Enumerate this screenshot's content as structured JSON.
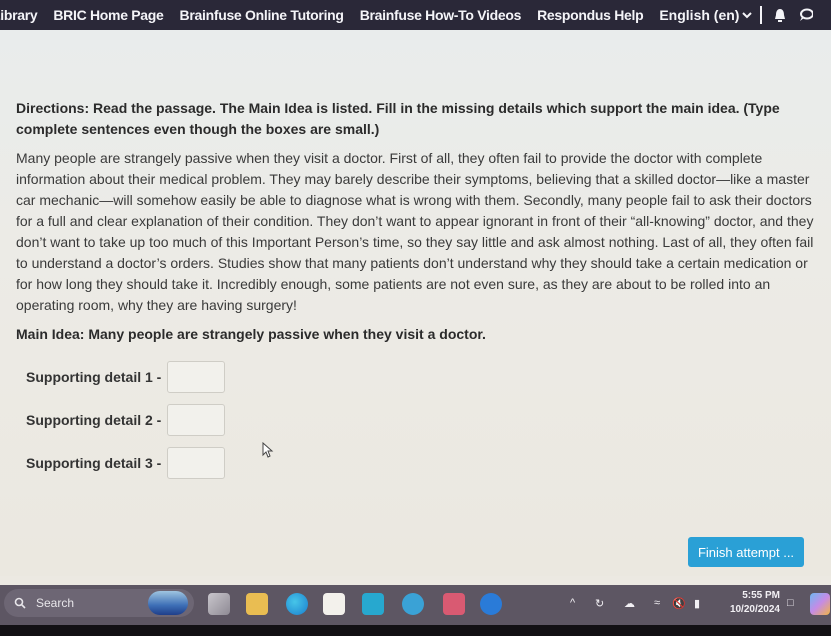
{
  "topnav": {
    "links": [
      "Library",
      "BRIC Home Page",
      "Brainfuse Online Tutoring",
      "Brainfuse How-To Videos",
      "Respondus Help"
    ],
    "language": "English (en)",
    "icons": [
      "chevron-down-icon",
      "bell-icon",
      "chat-icon"
    ]
  },
  "question": {
    "directions": "Directions: Read the passage. The Main Idea is listed.  Fill in the missing details which support the main idea. (Type complete sentences even though the boxes are small.)",
    "passage": "Many people are strangely passive when they visit a doctor. First of all, they often fail to provide the doctor with complete information about their medical problem. They may barely describe their symptoms, believing that a skilled doctor—like a master car mechanic—will somehow easily be able to diagnose what is wrong with them. Secondly, many people fail to ask their doctors for a full and clear explanation of their condition. They don’t want to appear ignorant in front of their “all-knowing” doctor, and they don’t want to take up too much of this Important Person’s time, so they say little and ask almost nothing. Last of all, they often fail to understand a doctor’s orders. Studies show that many patients don’t understand why they should take a certain medication or for how long they should take it. Incredibly enough, some patients are not even sure, as they are about to be rolled into an operating room, why they are having surgery!",
    "main_idea": "Main Idea: Many people are strangely passive when they visit a doctor.",
    "details": [
      {
        "label": "Supporting detail 1 -",
        "value": ""
      },
      {
        "label": "Supporting detail 2 -",
        "value": ""
      },
      {
        "label": "Supporting detail 3 -",
        "value": ""
      }
    ]
  },
  "actions": {
    "finish_label": "Finish attempt ..."
  },
  "taskbar": {
    "search_label": "Search",
    "apps": [
      "task-view",
      "file-explorer",
      "edge",
      "microsoft-store",
      "app-tile",
      "help",
      "mcafee",
      "facebook"
    ],
    "time": "5:55 PM",
    "date": "10/20/2024",
    "tray_icons": [
      "chevron-up-icon",
      "sync-icon",
      "cloud-icon",
      "wifi-icon",
      "mute-icon",
      "battery-icon",
      "notification-icon",
      "copilot-icon"
    ]
  }
}
